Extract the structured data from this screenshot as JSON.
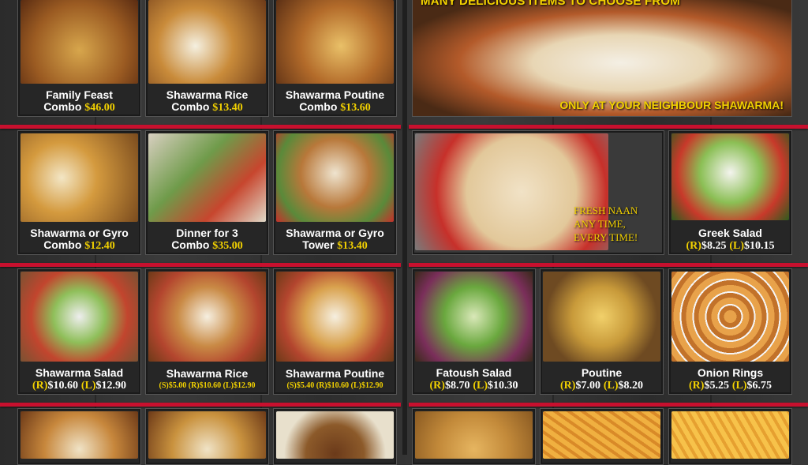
{
  "left": {
    "row1": [
      {
        "name": "Family Feast",
        "sub": "Combo",
        "price": "$46.00"
      },
      {
        "name": "Shawarma Rice",
        "sub": "Combo",
        "price": "$13.40"
      },
      {
        "name": "Shawarma Poutine",
        "sub": "Combo",
        "price": "$13.60"
      }
    ],
    "row2": [
      {
        "name": "Shawarma or Gyro",
        "sub": "Combo",
        "price": "$12.40"
      },
      {
        "name": "Dinner for 3",
        "sub": "Combo",
        "price": "$35.00"
      },
      {
        "name": "Shawarma or Gyro",
        "sub": "Tower",
        "price": "$13.40"
      }
    ],
    "row3": [
      {
        "name": "Shawarma Salad",
        "price1_label": "(R)",
        "price1": "$10.60",
        "price2_label": "(L)",
        "price2": "$12.90"
      },
      {
        "name": "Shawarma Rice",
        "small_prices": "(S)$5.00 (R)$10.60 (L)$12.90"
      },
      {
        "name": "Shawarma Poutine",
        "small_prices": "(S)$5.40 (R)$10.60 (L)$12.90"
      }
    ]
  },
  "right": {
    "banner_top": "MANY DELICIOUS ITEMS TO CHOOSE FROM",
    "banner_bottom": "ONLY AT YOUR NEIGHBOUR SHAWARMA!",
    "naan_line1": "FRESH NAAN",
    "naan_line2": "ANY TIME,",
    "naan_line3": "EVERY TIME!",
    "greek": {
      "name": "Greek Salad",
      "price1_label": "(R)",
      "price1": "$8.25",
      "price2_label": "(L)",
      "price2": "$10.15"
    },
    "row3": [
      {
        "name": "Fatoush Salad",
        "price1_label": "(R)",
        "price1": "$8.70",
        "price2_label": "(L)",
        "price2": "$10.30"
      },
      {
        "name": "Poutine",
        "price1_label": "(R)",
        "price1": "$7.00",
        "price2_label": "(L)",
        "price2": "$8.20"
      },
      {
        "name": "Onion Rings",
        "price1_label": "(R)",
        "price1": "$5.25",
        "price2_label": "(L)",
        "price2": "$6.75"
      }
    ]
  },
  "colors": {
    "accent_red": "#c8102e",
    "price_yellow": "#f2d100"
  }
}
